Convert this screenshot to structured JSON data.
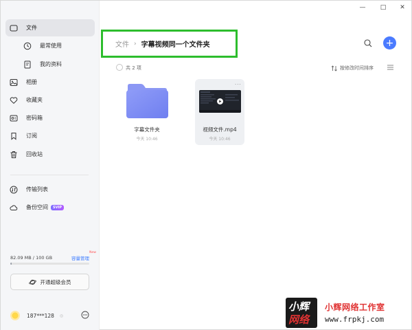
{
  "window": {
    "controls": [
      "—",
      "□",
      "✕"
    ]
  },
  "sidebar": {
    "items": [
      {
        "label": "文件",
        "icon": "file-icon",
        "active": true
      },
      {
        "label": "最常使用",
        "icon": "clock-icon"
      },
      {
        "label": "我的资料",
        "icon": "document-icon"
      },
      {
        "label": "相册",
        "icon": "photo-icon"
      },
      {
        "label": "收藏夹",
        "icon": "heart-icon"
      },
      {
        "label": "密码箱",
        "icon": "safe-icon"
      },
      {
        "label": "订阅",
        "icon": "bookmark-icon"
      },
      {
        "label": "回收站",
        "icon": "trash-icon"
      },
      {
        "label": "传输列表",
        "icon": "transfer-icon"
      },
      {
        "label": "备份空间",
        "icon": "cloud-icon",
        "badge": "SVIP"
      }
    ],
    "storage": {
      "used_text": "82.09 MB / 100 GB",
      "manage_link": "容量管理",
      "new_tag": "New",
      "used_fraction": 0.0008
    },
    "vip_button": "开通超级会员",
    "user": {
      "name": "187***128",
      "dot": "◎"
    }
  },
  "main": {
    "breadcrumb": {
      "root": "文件",
      "separator": "›",
      "current": "字幕视频同一个文件夹"
    },
    "toolbar": {
      "add_label": "+"
    },
    "list_header": {
      "count_text": "共 2 项",
      "sort_label": "按修改时间排序"
    },
    "files": [
      {
        "name": "字幕文件夹",
        "time": "今天 10:46",
        "type": "folder"
      },
      {
        "name": "视频文件.mp4",
        "time": "今天 10:46",
        "type": "video",
        "more": "···"
      }
    ]
  },
  "watermark": {
    "logo_top": "小辉",
    "logo_bottom": "网络",
    "name": "小辉网络工作室",
    "url": "www.frpkj.com"
  },
  "colors": {
    "accent": "#4b7bff",
    "highlight_box": "#2dbd2d",
    "folder": "#7b8cf5"
  }
}
